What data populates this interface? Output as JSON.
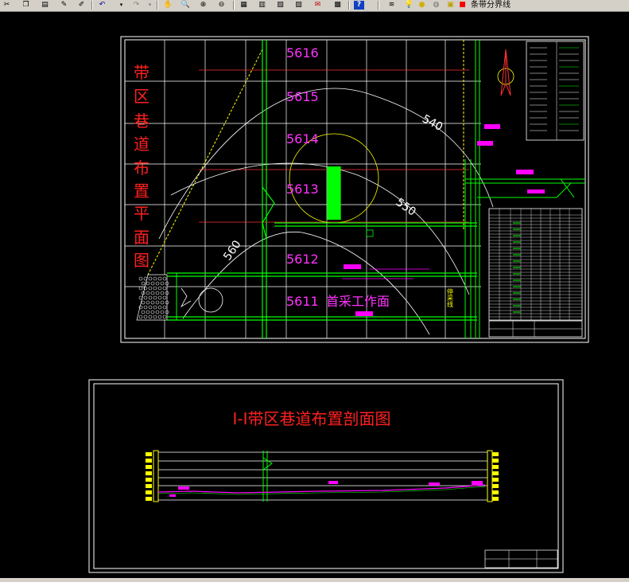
{
  "toolbar": {
    "icons": [
      "cut-icon",
      "copy-icon",
      "paste-icon",
      "match-properties-icon",
      "brush-icon",
      "undo-icon",
      "redo-icon",
      "pan-icon",
      "zoom-realtime-icon",
      "zoom-window-icon",
      "zoom-previous-icon",
      "properties-icon",
      "design-center-icon",
      "tool-palette-icon",
      "sheet-set-icon",
      "markup-icon",
      "calculator-icon",
      "help-icon",
      "layer-manager-icon",
      "bulb-icon",
      "sun-icon",
      "freeze-icon",
      "lock-icon",
      "color-icon"
    ],
    "layer_name": "条带分界线"
  },
  "plan": {
    "title_chars": [
      "带",
      "区",
      "巷",
      "道",
      "布",
      "置",
      "平",
      "面",
      "图"
    ],
    "strip_labels": [
      "5616",
      "5615",
      "5614",
      "5613",
      "5612",
      "5611"
    ],
    "workface_label": "首采工作面",
    "section_mark": "I",
    "contour_labels": [
      "540",
      "550",
      "560"
    ],
    "boundary_label": "停采线"
  },
  "section": {
    "title": "I-I带区巷道布置剖面图"
  },
  "colors": {
    "background": "#000000",
    "grid": "#ffffff",
    "red_text": "#ff2020",
    "magenta": "#ff00ff",
    "green": "#00ff00",
    "yellow": "#ffff00"
  }
}
